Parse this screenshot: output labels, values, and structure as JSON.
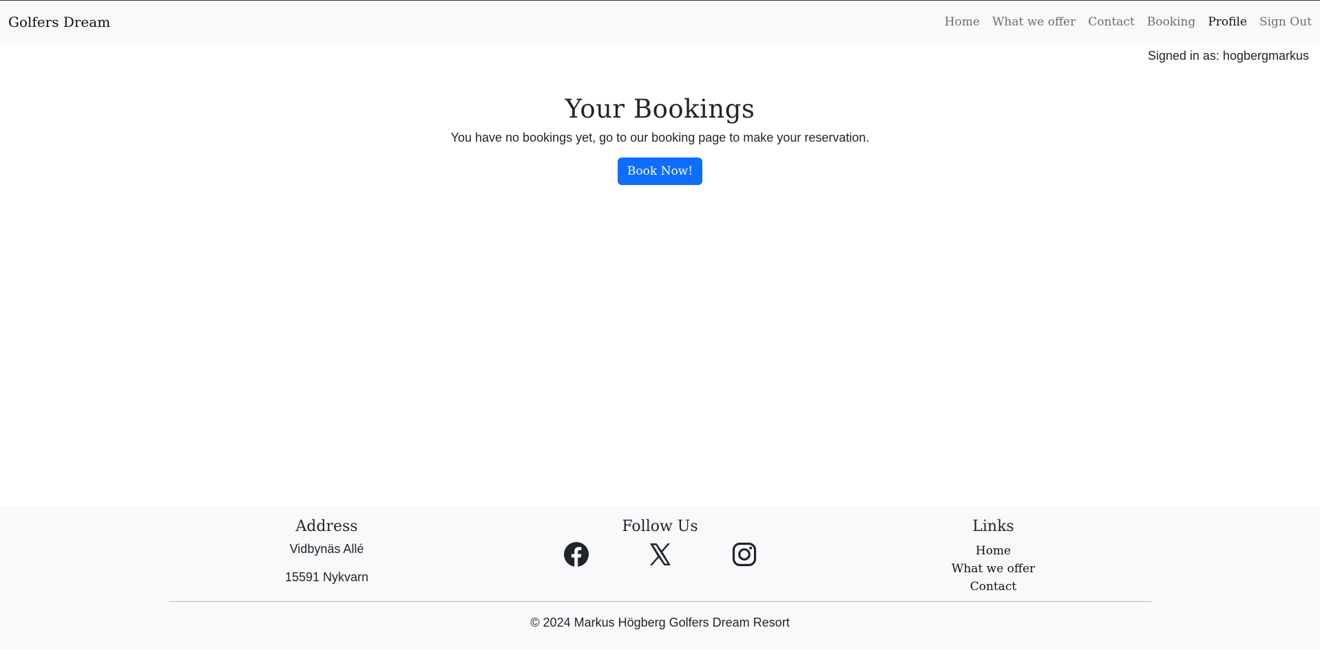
{
  "navbar": {
    "brand": "Golfers Dream",
    "links": [
      {
        "label": "Home"
      },
      {
        "label": "What we offer"
      },
      {
        "label": "Contact"
      },
      {
        "label": "Booking"
      },
      {
        "label": "Profile"
      },
      {
        "label": "Sign Out"
      }
    ]
  },
  "signed_in": "Signed in as: hogbergmarkus",
  "main": {
    "title": "Your Bookings",
    "message": "You have no bookings yet, go to our booking page to make your reservation.",
    "button_label": "Book Now!"
  },
  "footer": {
    "address": {
      "heading": "Address",
      "street": "Vidbynäs Allé",
      "city": "15591 Nykvarn"
    },
    "follow": {
      "heading": "Follow Us",
      "icons": [
        "facebook-icon",
        "x-icon",
        "instagram-icon"
      ]
    },
    "links": {
      "heading": "Links",
      "items": [
        {
          "label": "Home"
        },
        {
          "label": "What we offer"
        },
        {
          "label": "Contact"
        }
      ]
    },
    "copyright": "© 2024 Markus Högberg Golfers Dream Resort"
  },
  "colors": {
    "navbar_bg": "#f8f9fa",
    "primary_button": "#0d6efd",
    "nav_link": "#6c6c6c",
    "active_link": "#111111"
  }
}
